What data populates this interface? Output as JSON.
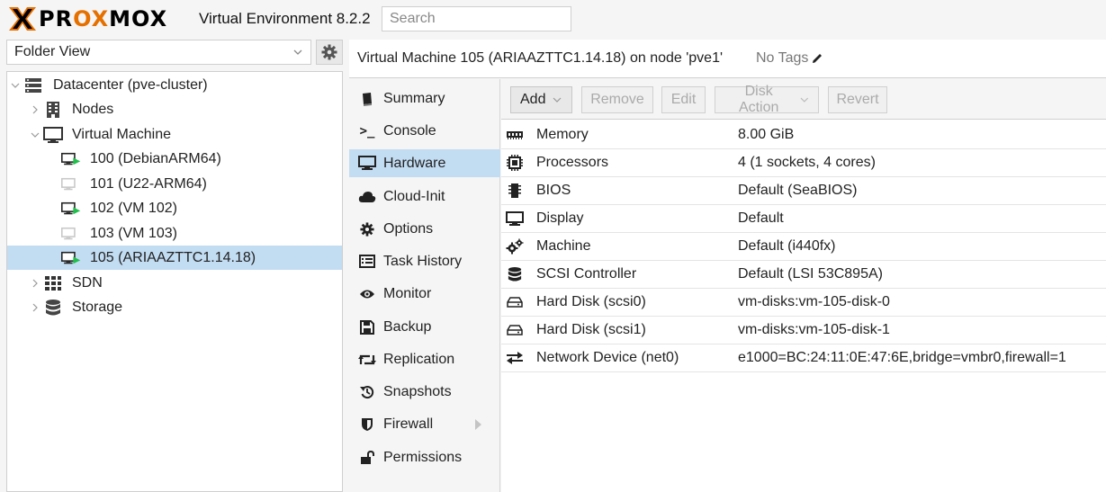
{
  "app": {
    "brand": "PROXMOX",
    "version": "Virtual Environment 8.2.2",
    "search_placeholder": "Search"
  },
  "left": {
    "view_selector": "Folder View",
    "tree": [
      {
        "label": "Datacenter (pve-cluster)",
        "icon": "datacenter-icon"
      },
      {
        "label": "Nodes",
        "icon": "building-icon"
      },
      {
        "label": "Virtual Machine",
        "icon": "monitor-icon"
      },
      {
        "label": "100 (DebianARM64)",
        "icon": "vm-running-icon",
        "status": "running"
      },
      {
        "label": "101 (U22-ARM64)",
        "icon": "vm-stopped-icon",
        "status": "stopped"
      },
      {
        "label": "102 (VM 102)",
        "icon": "vm-running-icon",
        "status": "running"
      },
      {
        "label": "103 (VM 103)",
        "icon": "vm-stopped-icon",
        "status": "stopped"
      },
      {
        "label": "105 (ARIAAZTTC1.14.18)",
        "icon": "vm-running-icon",
        "status": "running",
        "selected": true
      },
      {
        "label": "SDN",
        "icon": "grid-icon"
      },
      {
        "label": "Storage",
        "icon": "database-icon"
      }
    ]
  },
  "header": {
    "title": "Virtual Machine 105 (ARIAAZTTC1.14.18) on node 'pve1'",
    "tags": "No Tags"
  },
  "subnav": [
    {
      "label": "Summary",
      "icon": "book-icon"
    },
    {
      "label": "Console",
      "icon": "terminal-icon"
    },
    {
      "label": "Hardware",
      "icon": "desktop-icon",
      "active": true
    },
    {
      "label": "Cloud-Init",
      "icon": "cloud-icon"
    },
    {
      "label": "Options",
      "icon": "gear-icon"
    },
    {
      "label": "Task History",
      "icon": "list-icon"
    },
    {
      "label": "Monitor",
      "icon": "eye-icon"
    },
    {
      "label": "Backup",
      "icon": "floppy-icon"
    },
    {
      "label": "Replication",
      "icon": "retweet-icon"
    },
    {
      "label": "Snapshots",
      "icon": "history-icon"
    },
    {
      "label": "Firewall",
      "icon": "shield-icon"
    },
    {
      "label": "Permissions",
      "icon": "unlock-icon"
    }
  ],
  "toolbar": {
    "add": "Add",
    "remove": "Remove",
    "edit": "Edit",
    "disk_action": "Disk Action",
    "revert": "Revert"
  },
  "hardware": [
    {
      "name": "Memory",
      "value": "8.00 GiB",
      "icon": "memory-icon"
    },
    {
      "name": "Processors",
      "value": "4 (1 sockets, 4 cores)",
      "icon": "cpu-icon"
    },
    {
      "name": "BIOS",
      "value": "Default (SeaBIOS)",
      "icon": "chip-icon"
    },
    {
      "name": "Display",
      "value": "Default",
      "icon": "display-icon"
    },
    {
      "name": "Machine",
      "value": "Default (i440fx)",
      "icon": "cogs-icon"
    },
    {
      "name": "SCSI Controller",
      "value": "Default (LSI 53C895A)",
      "icon": "database-icon"
    },
    {
      "name": "Hard Disk (scsi0)",
      "value": "vm-disks:vm-105-disk-0",
      "icon": "hdd-icon"
    },
    {
      "name": "Hard Disk (scsi1)",
      "value": "vm-disks:vm-105-disk-1",
      "icon": "hdd-icon"
    },
    {
      "name": "Network Device (net0)",
      "value": "e1000=BC:24:11:0E:47:6E,bridge=vmbr0,firewall=1",
      "icon": "exchange-icon"
    }
  ],
  "colors": {
    "brand_orange": "#e57000",
    "selection": "#c2dcf2",
    "running_green": "#21bf4b"
  }
}
